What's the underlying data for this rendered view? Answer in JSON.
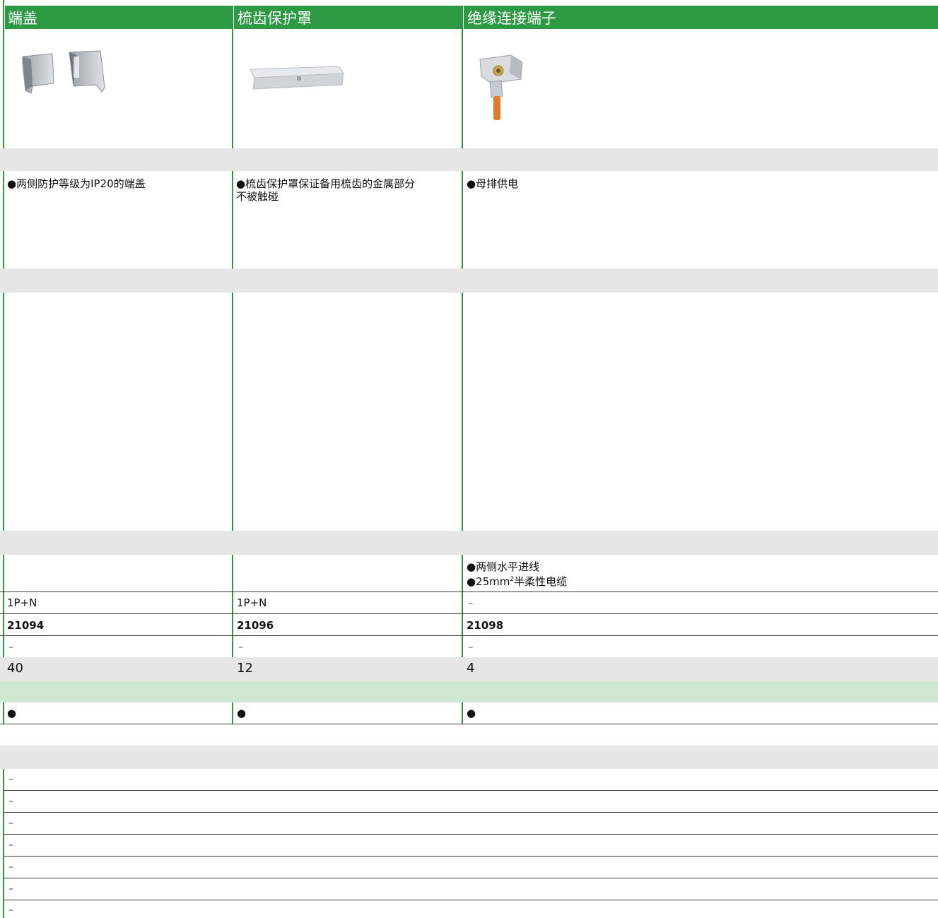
{
  "headers": [
    "端盖",
    "梳齿保护罩",
    "绝缘连接端子"
  ],
  "descriptions": {
    "col1": "●两侧防护等级为IP20的端盖",
    "col2_line1": "●梳齿保护罩保证备用梳齿的金属部分",
    "col2_line2": "不被触碰",
    "col3": "●母排供电"
  },
  "features": {
    "col3_line1": "●两侧水平进线",
    "col3_line2_prefix": "●25mm",
    "col3_line2_sup": "2",
    "col3_line2_suffix": "半柔性电缆"
  },
  "rows": {
    "poles": [
      "1P+N",
      "1P+N",
      "–"
    ],
    "refs": [
      "21094",
      "21096",
      "21098"
    ],
    "other": [
      "–",
      "–",
      "–"
    ],
    "qty": [
      "40",
      "12",
      "4"
    ],
    "dot": [
      "●",
      "●",
      "●"
    ]
  },
  "lower_dashes": [
    "–",
    "–",
    "–",
    "–",
    "–",
    "–",
    "–"
  ],
  "colors": {
    "green": "#2b9a42",
    "light_green": "#cfe6d3",
    "grey_band": "#e6e6e6"
  }
}
